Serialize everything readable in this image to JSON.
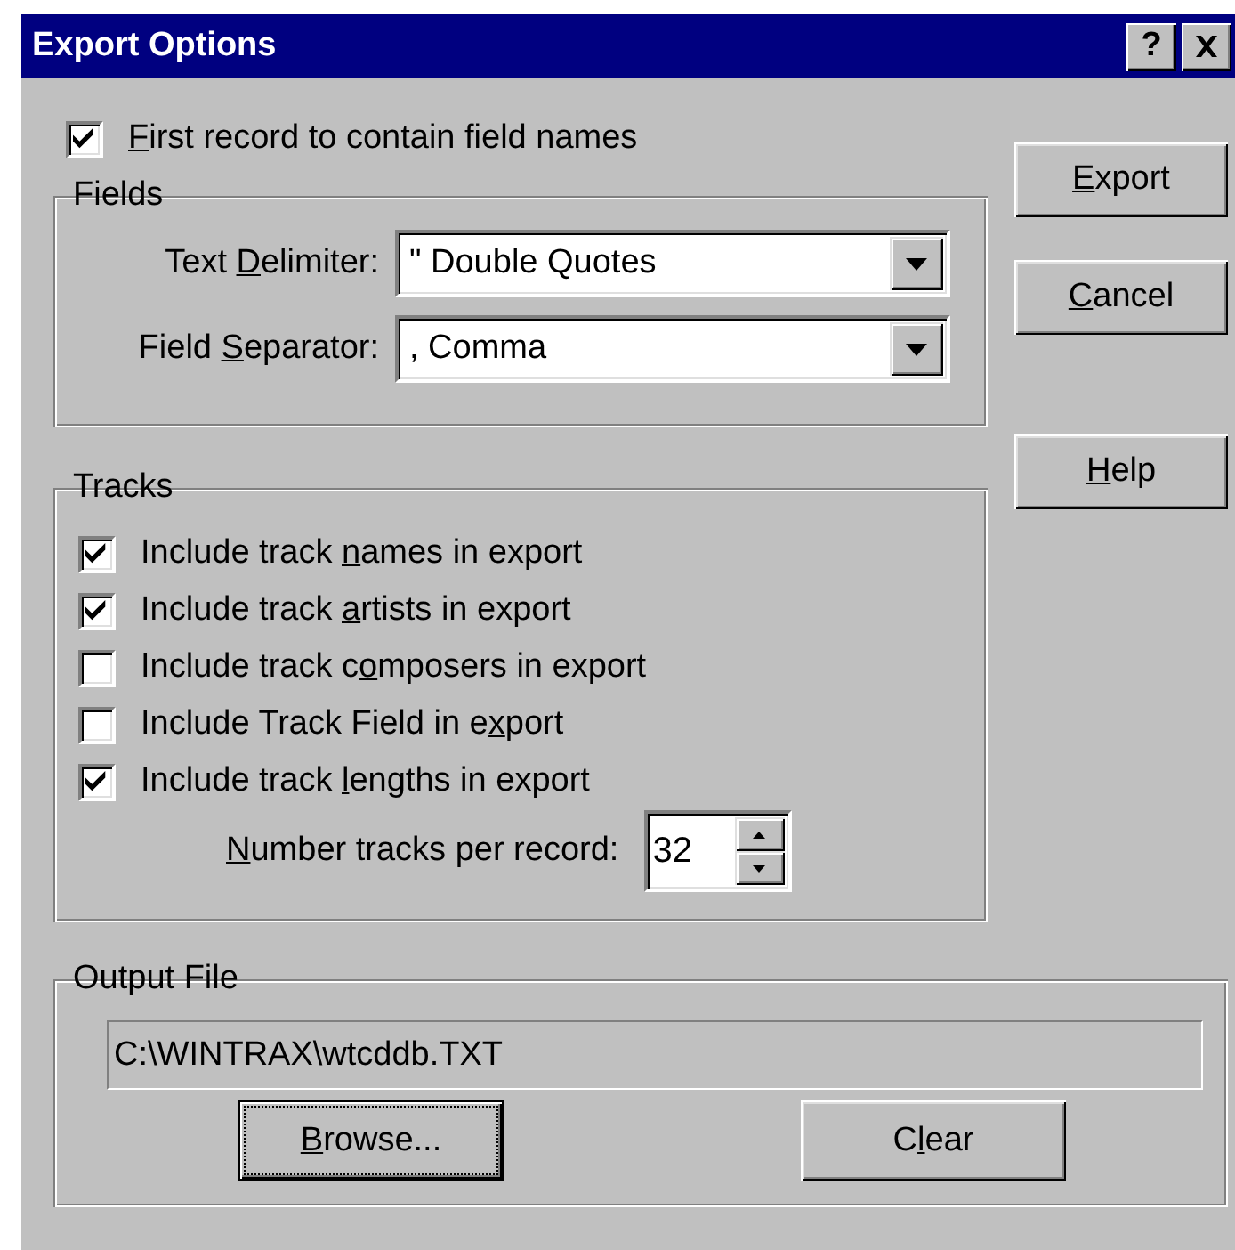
{
  "window": {
    "title": "Export Options",
    "help_button": "?"
  },
  "first_record": {
    "checked": true,
    "label": {
      "access_key": "F",
      "text_after": "irst record to contain field names"
    }
  },
  "fields_group": {
    "title": "Fields",
    "rows": [
      {
        "label": {
          "text_before": "Text ",
          "access_key": "D",
          "text_after": "elimiter:"
        },
        "value": "\" Double Quotes"
      },
      {
        "label": {
          "text_before": "Field ",
          "access_key": "S",
          "text_after": "eparator:"
        },
        "value": ", Comma"
      }
    ]
  },
  "tracks_group": {
    "title": "Tracks",
    "options": [
      {
        "checked": true,
        "label": {
          "text_before": "Include track ",
          "access_key": "n",
          "text_after": "ames in export"
        }
      },
      {
        "checked": true,
        "label": {
          "text_before": "Include track ",
          "access_key": "a",
          "text_after": "rtists in export"
        }
      },
      {
        "checked": false,
        "label": {
          "text_before": "Include track c",
          "access_key": "o",
          "text_after": "mposers in export"
        }
      },
      {
        "checked": false,
        "label": {
          "text_before": "Include Track Field in e",
          "access_key": "x",
          "text_after": "port"
        }
      },
      {
        "checked": true,
        "label": {
          "text_before": "Include track ",
          "access_key": "l",
          "text_after": "engths in export"
        }
      }
    ],
    "tracks_per_record": {
      "label": {
        "access_key": "N",
        "text_after": "umber tracks per record:"
      },
      "value": "32"
    }
  },
  "output_group": {
    "title": "Output File",
    "path": {
      "value": "C:\\WINTRAX\\wtcddb.TXT",
      "read_only": true
    },
    "buttons": [
      {
        "label": {
          "access_key": "B",
          "text_after": "rowse..."
        },
        "focused": true
      },
      {
        "label": {
          "text_before": "C",
          "access_key": "l",
          "text_after": "ear"
        },
        "focused": false
      }
    ]
  },
  "buttons": [
    {
      "label": {
        "access_key": "E",
        "text_after": "xport"
      },
      "focused": false
    },
    {
      "label": {
        "access_key": "C",
        "text_after": "ancel"
      },
      "focused": false
    },
    {
      "label": {
        "access_key": "H",
        "text_after": "elp"
      },
      "focused": false
    }
  ]
}
